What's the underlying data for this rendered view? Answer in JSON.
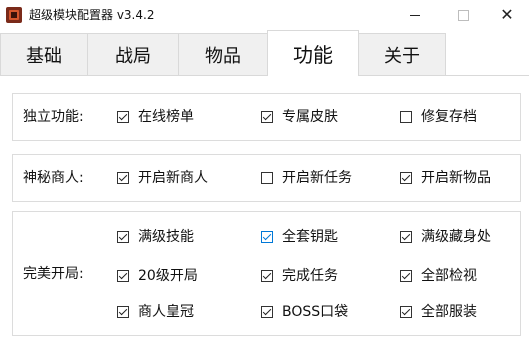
{
  "window": {
    "title": "超级模块配置器 v3.4.2",
    "controls": {
      "minimize": "—",
      "maximize": "□",
      "close": "✕"
    },
    "icon": "app-logo-icon"
  },
  "tabs": [
    {
      "label": "基础",
      "active": false
    },
    {
      "label": "战局",
      "active": false
    },
    {
      "label": "物品",
      "active": false
    },
    {
      "label": "功能",
      "active": true
    },
    {
      "label": "关于",
      "active": false
    }
  ],
  "groups": {
    "standalone": {
      "label": "独立功能:",
      "options": [
        {
          "label": "在线榜单",
          "checked": true
        },
        {
          "label": "专属皮肤",
          "checked": true
        },
        {
          "label": "修复存档",
          "checked": false
        }
      ]
    },
    "merchant": {
      "label": "神秘商人:",
      "options": [
        {
          "label": "开启新商人",
          "checked": true
        },
        {
          "label": "开启新任务",
          "checked": false
        },
        {
          "label": "开启新物品",
          "checked": true
        }
      ]
    },
    "perfect_start": {
      "label": "完美开局:",
      "options": [
        {
          "label": "满级技能",
          "checked": true
        },
        {
          "label": "全套钥匙",
          "checked": true,
          "focused": true
        },
        {
          "label": "满级藏身处",
          "checked": true
        },
        {
          "label": "20级开局",
          "checked": true
        },
        {
          "label": "完成任务",
          "checked": true
        },
        {
          "label": "全部检视",
          "checked": true
        },
        {
          "label": "商人皇冠",
          "checked": true
        },
        {
          "label": "BOSS口袋",
          "checked": true
        },
        {
          "label": "全部服装",
          "checked": true
        }
      ]
    }
  },
  "colors": {
    "focus_accent": "#0078d7",
    "tab_inactive_bg": "#f0f0f0",
    "border": "#d9d9d9"
  }
}
